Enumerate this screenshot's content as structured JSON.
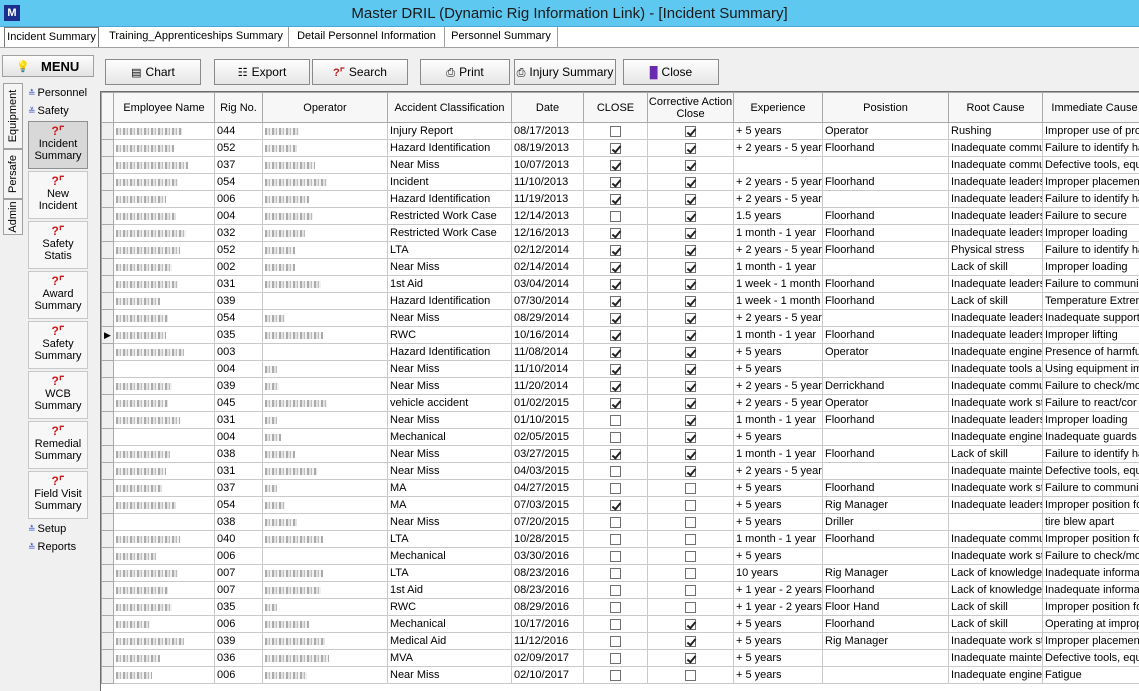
{
  "window": {
    "title": "Master DRIL (Dynamic Rig Information Link) - [Incident Summary]"
  },
  "tabs": [
    "Incident Summary",
    "Training_Apprenticeships Summary",
    "Detail Personnel Information",
    "Personnel Summary"
  ],
  "menu": {
    "label": "MENU",
    "icon": "lightbulb-icon"
  },
  "vertical_tabs": [
    "Equipment",
    "Persafe",
    "Admin"
  ],
  "sections": {
    "personnel": "Personnel",
    "safety": "Safety",
    "setup": "Setup",
    "reports": "Reports"
  },
  "nav_buttons": [
    {
      "line1": "Incident",
      "line2": "Summary"
    },
    {
      "line1": "New",
      "line2": "Incident"
    },
    {
      "line1": "Safety",
      "line2": "Statis"
    },
    {
      "line1": "Award",
      "line2": "Summary"
    },
    {
      "line1": "Safety",
      "line2": "Summary"
    },
    {
      "line1": "WCB",
      "line2": "Summary"
    },
    {
      "line1": "Remedial",
      "line2": "Summary"
    },
    {
      "line1": "Field Visit",
      "line2": "Summary"
    }
  ],
  "toolbar": {
    "chart": "Chart",
    "export": "Export",
    "search": "Search",
    "print": "Print",
    "injury_summary": "Injury Summary",
    "close": "Close"
  },
  "table": {
    "columns": [
      "Employee Name",
      "Rig No.",
      "Operator",
      "Accident Classification",
      "Date",
      "CLOSE",
      "Corrective Action Close",
      "Experience",
      "Posistion",
      "Root Cause",
      "Immediate Cause"
    ],
    "rows": [
      {
        "rig": "044",
        "cls": "Injury Report",
        "date": "08/17/2013",
        "close": false,
        "cac": true,
        "exp": "+ 5 years",
        "pos": "Operator",
        "root": "Rushing",
        "imm": "Improper use of pro"
      },
      {
        "rig": "052",
        "cls": "Hazard Identification",
        "date": "08/19/2013",
        "close": true,
        "cac": true,
        "exp": "+ 2 years - 5 years",
        "pos": "Floorhand",
        "root": "Inadequate commu",
        "imm": "Failure to identify ha"
      },
      {
        "rig": "037",
        "cls": "Near Miss",
        "date": "10/07/2013",
        "close": true,
        "cac": true,
        "exp": "",
        "pos": "",
        "root": "Inadequate commu",
        "imm": "Defective tools, equ"
      },
      {
        "rig": "054",
        "cls": "Incident",
        "date": "11/10/2013",
        "close": true,
        "cac": true,
        "exp": "+ 2 years - 5 years",
        "pos": "Floorhand",
        "root": "Inadequate leaders",
        "imm": "Improper placement"
      },
      {
        "rig": "006",
        "cls": "Hazard Identification",
        "date": "11/19/2013",
        "close": true,
        "cac": true,
        "exp": "+ 2 years - 5 years",
        "pos": "",
        "root": "Inadequate leaders",
        "imm": "Failure to identify ha"
      },
      {
        "rig": "004",
        "cls": "Restricted Work Case",
        "date": "12/14/2013",
        "close": false,
        "cac": true,
        "exp": "1.5 years",
        "pos": "Floorhand",
        "root": "Inadequate leaders",
        "imm": "Failure to secure"
      },
      {
        "rig": "032",
        "cls": "Restricted Work Case",
        "date": "12/16/2013",
        "close": true,
        "cac": true,
        "exp": "1 month - 1 year",
        "pos": "Floorhand",
        "root": "Inadequate leaders",
        "imm": "Improper loading"
      },
      {
        "rig": "052",
        "cls": "LTA",
        "date": "02/12/2014",
        "close": true,
        "cac": true,
        "exp": "+ 2 years - 5 years",
        "pos": "Floorhand",
        "root": "Physical stress",
        "imm": "Failure to identify ha"
      },
      {
        "rig": "002",
        "cls": "Near Miss",
        "date": "02/14/2014",
        "close": true,
        "cac": true,
        "exp": "1 month - 1 year",
        "pos": "",
        "root": "Lack of skill",
        "imm": "Improper loading"
      },
      {
        "rig": "031",
        "cls": "1st Aid",
        "date": "03/04/2014",
        "close": true,
        "cac": true,
        "exp": "1 week - 1 month",
        "pos": "Floorhand",
        "root": "Inadequate leaders",
        "imm": "Failure to communic"
      },
      {
        "rig": "039",
        "cls": "Hazard Identification",
        "date": "07/30/2014",
        "close": true,
        "cac": true,
        "exp": "1 week - 1 month",
        "pos": "Floorhand",
        "root": "Lack of skill",
        "imm": "Temperature Extren"
      },
      {
        "rig": "054",
        "cls": "Near Miss",
        "date": "08/29/2014",
        "close": true,
        "cac": true,
        "exp": "+ 2 years - 5 years",
        "pos": "",
        "root": "Inadequate leaders",
        "imm": "Inadequate support"
      },
      {
        "rig": "035",
        "cls": "RWC",
        "date": "10/16/2014",
        "close": true,
        "cac": true,
        "exp": "1 month - 1 year",
        "pos": "Floorhand",
        "root": "Inadequate leaders",
        "imm": "Improper lifting"
      },
      {
        "rig": "003",
        "cls": "Hazard Identification",
        "date": "11/08/2014",
        "close": true,
        "cac": true,
        "exp": "+ 5 years",
        "pos": "Operator",
        "root": "Inadequate enginee",
        "imm": "Presence of harmfu"
      },
      {
        "rig": "004",
        "cls": "Near Miss",
        "date": "11/10/2014",
        "close": true,
        "cac": true,
        "exp": "+ 5 years",
        "pos": "",
        "root": "Inadequate tools ar",
        "imm": "Using equipment im"
      },
      {
        "rig": "039",
        "cls": "Near Miss",
        "date": "11/20/2014",
        "close": true,
        "cac": true,
        "exp": "+ 2 years - 5 years",
        "pos": "Derrickhand",
        "root": "Inadequate commu",
        "imm": "Failure to check/mo"
      },
      {
        "rig": "045",
        "cls": "vehicle accident",
        "date": "01/02/2015",
        "close": true,
        "cac": true,
        "exp": "+ 2 years - 5 years",
        "pos": "Operator",
        "root": "Inadequate work st",
        "imm": "Failure to react/cor"
      },
      {
        "rig": "031",
        "cls": "Near Miss",
        "date": "01/10/2015",
        "close": false,
        "cac": true,
        "exp": "1 month - 1 year",
        "pos": "Floorhand",
        "root": "Inadequate leaders",
        "imm": "Improper loading"
      },
      {
        "rig": "004",
        "cls": "Mechanical",
        "date": "02/05/2015",
        "close": false,
        "cac": true,
        "exp": "+ 5 years",
        "pos": "",
        "root": "Inadequate enginee",
        "imm": "Inadequate guards"
      },
      {
        "rig": "038",
        "cls": "Near Miss",
        "date": "03/27/2015",
        "close": true,
        "cac": true,
        "exp": "1 month - 1 year",
        "pos": "Floorhand",
        "root": "Lack of skill",
        "imm": "Failure to identify ha"
      },
      {
        "rig": "031",
        "cls": "Near Miss",
        "date": "04/03/2015",
        "close": false,
        "cac": true,
        "exp": "+ 2 years - 5 years",
        "pos": "",
        "root": "Inadequate mainter",
        "imm": "Defective tools, equ"
      },
      {
        "rig": "037",
        "cls": "MA",
        "date": "04/27/2015",
        "close": false,
        "cac": false,
        "exp": "+ 5 years",
        "pos": "Floorhand",
        "root": "Inadequate work st",
        "imm": "Failure to communic"
      },
      {
        "rig": "054",
        "cls": "MA",
        "date": "07/03/2015",
        "close": true,
        "cac": false,
        "exp": "+ 5 years",
        "pos": "Rig Manager",
        "root": "Inadequate leaders",
        "imm": "Improper position fo"
      },
      {
        "rig": "038",
        "cls": "Near Miss",
        "date": "07/20/2015",
        "close": false,
        "cac": false,
        "exp": "+ 5 years",
        "pos": "Driller",
        "root": "",
        "imm": "tire blew apart"
      },
      {
        "rig": "040",
        "cls": "LTA",
        "date": "10/28/2015",
        "close": false,
        "cac": false,
        "exp": "1 month - 1 year",
        "pos": "Floorhand",
        "root": "Inadequate commu",
        "imm": "Improper position fo"
      },
      {
        "rig": "006",
        "cls": "Mechanical",
        "date": "03/30/2016",
        "close": false,
        "cac": false,
        "exp": "+ 5 years",
        "pos": "",
        "root": "Inadequate work st",
        "imm": "Failure to check/mo"
      },
      {
        "rig": "007",
        "cls": "LTA",
        "date": "08/23/2016",
        "close": false,
        "cac": false,
        "exp": "10 years",
        "pos": "Rig Manager",
        "root": "Lack of knowledge",
        "imm": "Inadequate informa"
      },
      {
        "rig": "007",
        "cls": "1st Aid",
        "date": "08/23/2016",
        "close": false,
        "cac": false,
        "exp": "+ 1 year - 2 years",
        "pos": "Floorhand",
        "root": "Lack of knowledge",
        "imm": "Inadequate informa"
      },
      {
        "rig": "035",
        "cls": "RWC",
        "date": "08/29/2016",
        "close": false,
        "cac": false,
        "exp": "+ 1 year - 2 years",
        "pos": "Floor Hand",
        "root": "Lack of skill",
        "imm": "Improper position fo"
      },
      {
        "rig": "006",
        "cls": "Mechanical",
        "date": "10/17/2016",
        "close": false,
        "cac": true,
        "exp": "+ 5 years",
        "pos": "Floorhand",
        "root": "Lack of skill",
        "imm": "Operating at improp"
      },
      {
        "rig": "039",
        "cls": "Medical Aid",
        "date": "11/12/2016",
        "close": false,
        "cac": true,
        "exp": "+ 5 years",
        "pos": "Rig Manager",
        "root": "Inadequate work st",
        "imm": "Improper placement"
      },
      {
        "rig": "036",
        "cls": "MVA",
        "date": "02/09/2017",
        "close": false,
        "cac": true,
        "exp": "+ 5 years",
        "pos": "",
        "root": "Inadequate mainter",
        "imm": "Defective tools, equ"
      },
      {
        "rig": "006",
        "cls": "Near Miss",
        "date": "02/10/2017",
        "close": false,
        "cac": false,
        "exp": "+ 5 years",
        "pos": "",
        "root": "Inadequate enginee",
        "imm": "Fatigue"
      }
    ]
  }
}
